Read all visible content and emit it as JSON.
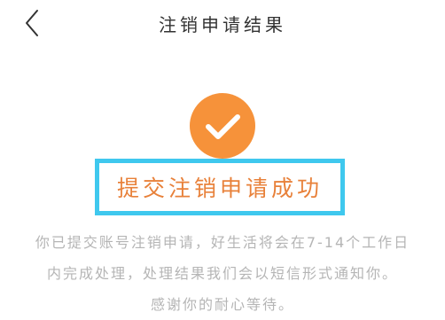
{
  "header": {
    "back_icon": "chevron-left-icon",
    "title": "注销申请结果"
  },
  "result": {
    "icon": "check-circle-icon",
    "status": "提交注销申请成功"
  },
  "description": {
    "line1": "你已提交账号注销申请，好生活将会在7-14个工作日",
    "line2": "内完成处理，处理结果我们会以短信形式通知你。",
    "line3": "感谢你的耐心等待。"
  },
  "colors": {
    "accent_orange": "#F6923A",
    "status_text": "#E8813A",
    "highlight_border": "#3FC8EE",
    "muted_text": "#B5B5B5"
  }
}
